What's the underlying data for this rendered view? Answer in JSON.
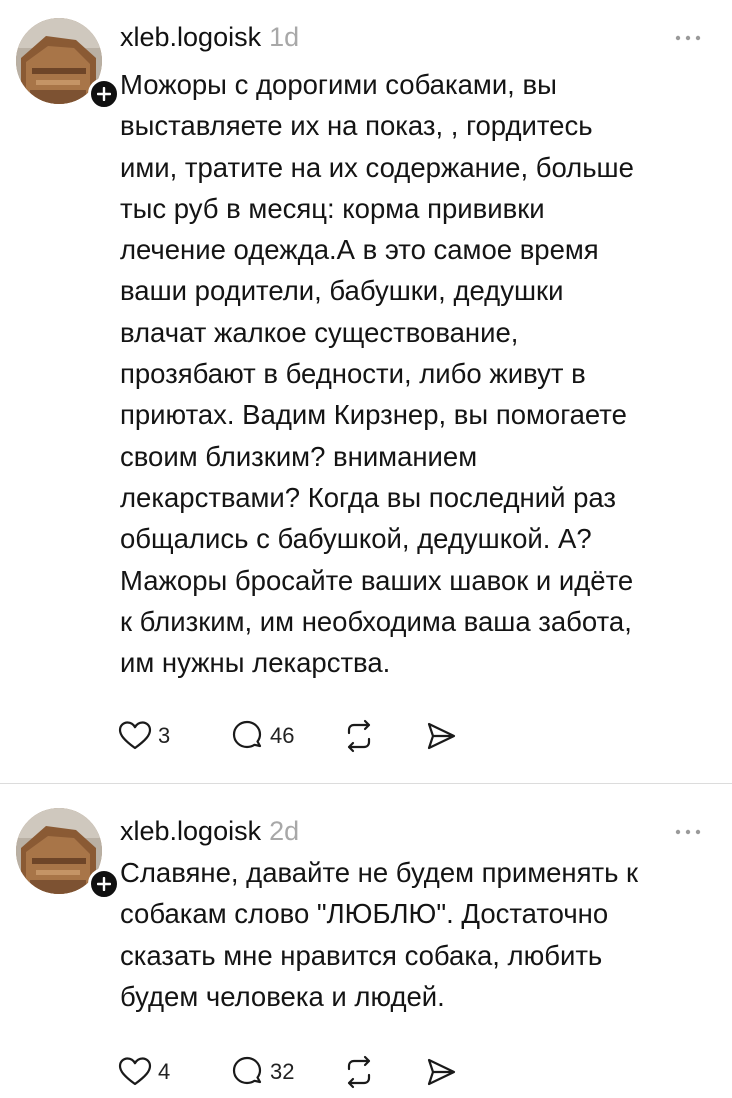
{
  "posts": [
    {
      "username": "xleb.logoisk",
      "time": "1d",
      "text": "Можоры с дорогими собаками, вы\nвыставляете их на показ, , гордитесь\nими, тратите на их содержание, больше\nтыс руб в месяц: корма прививки\nлечение одежда.А в это самое время\nваши родители, бабушки, дедушки\nвлачат жалкое существование,\nпрозябают в бедности, либо живут в\nприютах. Вадим Кирзнер, вы помогаете\nсвоим близким? вниманием\nлекарствами? Когда вы последний раз\nобщались с бабушкой, дедушкой. А?\nМажоры бросайте ваших шавок и идёте\nк близким, им необходима ваша забота,\nим нужны лекарства.",
      "likes": "3",
      "replies": "46"
    },
    {
      "username": "xleb.logoisk",
      "time": "2d",
      "text": "Славяне, давайте не будем применять к\nсобакам слово \"ЛЮБЛЮ\". Достаточно\nсказать мне нравится собака, любить\nбудем человека и людей.",
      "likes": "4",
      "replies": "32"
    }
  ],
  "icons": {
    "like": "heart-icon",
    "reply": "speech-bubble-icon",
    "repost": "repost-arrows-icon",
    "share": "send-icon",
    "more": "ellipsis-icon",
    "follow": "plus-icon"
  },
  "colors": {
    "text": "#141414",
    "muted": "#a8a8a8",
    "divider": "#dcdcdc",
    "badge": "#101010"
  }
}
